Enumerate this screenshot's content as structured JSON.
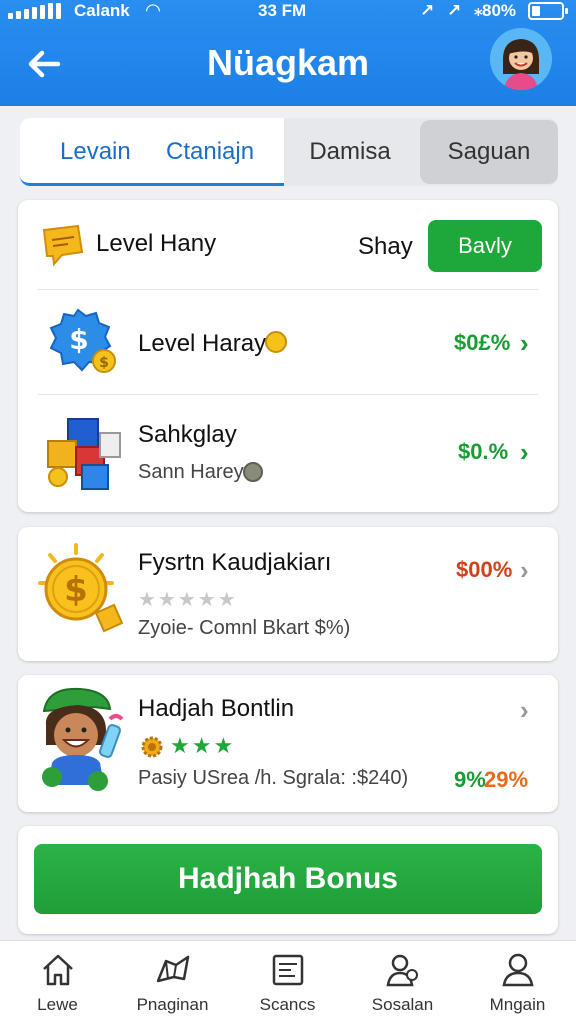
{
  "status_bar": {
    "carrier": "Calank",
    "time": "33 FM",
    "indicators": "↗ ↗ ⁎",
    "battery": "80%"
  },
  "header": {
    "title": "Nüagkam",
    "back_icon": "arrow-left-icon",
    "avatar": "user-avatar"
  },
  "tabs": {
    "items": [
      {
        "label": "Levain"
      },
      {
        "label": "Ctaniajn"
      },
      {
        "label": "Damisa"
      },
      {
        "label": "Saguan"
      }
    ]
  },
  "card1": {
    "header": {
      "title": "Level Hany",
      "price_label": "Shay",
      "buy_button": "Bavly",
      "icon": "ticket-icon"
    },
    "rows": [
      {
        "title": "Level Haray",
        "percent": "$0£%",
        "icon": "dollar-badge-icon",
        "percent_color": "#1a9c34"
      },
      {
        "title": "Sahkglay",
        "subtitle": "Sann Harey",
        "percent": "$0.%",
        "icon": "boxes-icon",
        "percent_color": "#1a9c34"
      }
    ]
  },
  "card2": {
    "title": "Fysrtn Kaudjakiarı",
    "rating": "★★★★★",
    "subtitle": "Zyoie- Comnl Bkart $%)",
    "percent": "$00%",
    "icon": "gold-coin-icon",
    "percent_color": "#d2401a"
  },
  "card3": {
    "title": "Hadjah Bontlin",
    "stars": "★★★",
    "subtitle": "Pasiy USrea /h. Sgrala: :$240)",
    "percent_green": "9%",
    "percent_orange": "29%",
    "icon": "character-icon"
  },
  "card4": {
    "button": "Hadjhah Bonus"
  },
  "bottom_nav": {
    "items": [
      {
        "label": "Lewe",
        "icon": "home-icon"
      },
      {
        "label": "Pnaginan",
        "icon": "map-icon"
      },
      {
        "label": "Scancs",
        "icon": "document-icon"
      },
      {
        "label": "Sosalan",
        "icon": "user-search-icon"
      },
      {
        "label": "Mngain",
        "icon": "profile-icon"
      }
    ]
  },
  "colors": {
    "header_blue": "#1c7fe6",
    "accent_green": "#1fa83a",
    "percent_green": "#1a9c34",
    "percent_red": "#d2401a"
  }
}
